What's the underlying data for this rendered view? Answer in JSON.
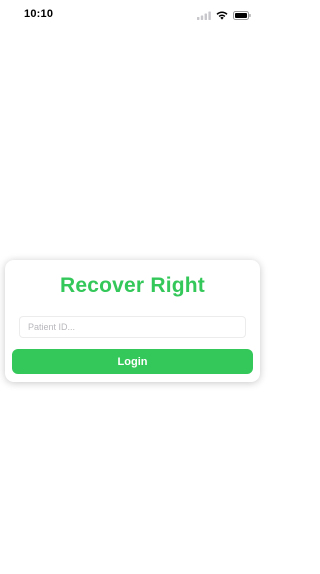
{
  "status_bar": {
    "time": "10:10",
    "icons": [
      "cellular-signal-icon",
      "wifi-icon",
      "battery-icon"
    ]
  },
  "login_card": {
    "title": "Recover Right",
    "patient_id": {
      "value": "",
      "placeholder": "Patient ID..."
    },
    "login_button_label": "Login"
  },
  "colors": {
    "accent": "#34c759",
    "background": "#ffffff",
    "placeholder": "#b8b8bd"
  }
}
